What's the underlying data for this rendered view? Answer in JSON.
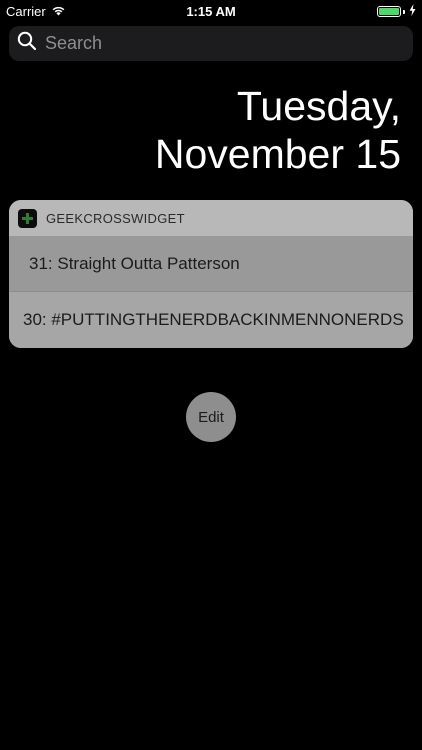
{
  "status_bar": {
    "carrier": "Carrier",
    "time": "1:15 AM",
    "battery_level": 1.0,
    "icons": [
      "wifi-icon",
      "battery-icon",
      "charging-bolt-icon"
    ]
  },
  "search": {
    "placeholder": "Search"
  },
  "date": {
    "line1": "Tuesday,",
    "line2": "November 15"
  },
  "widget": {
    "app_name": "GEEKCROSSWIDGET",
    "icon": "geekcross-app-icon",
    "items": [
      {
        "label": "31: Straight Outta Patterson"
      },
      {
        "label": "30: #PUTTINGTHENERDBACKINMENNONERDS"
      }
    ]
  },
  "edit_button": {
    "label": "Edit"
  },
  "colors": {
    "background": "#000000",
    "battery_fill": "#4cd964",
    "widget_header": "#b8b8b8",
    "widget_body": "#9b9b9b",
    "app_icon_cross": "#2e7d32"
  }
}
